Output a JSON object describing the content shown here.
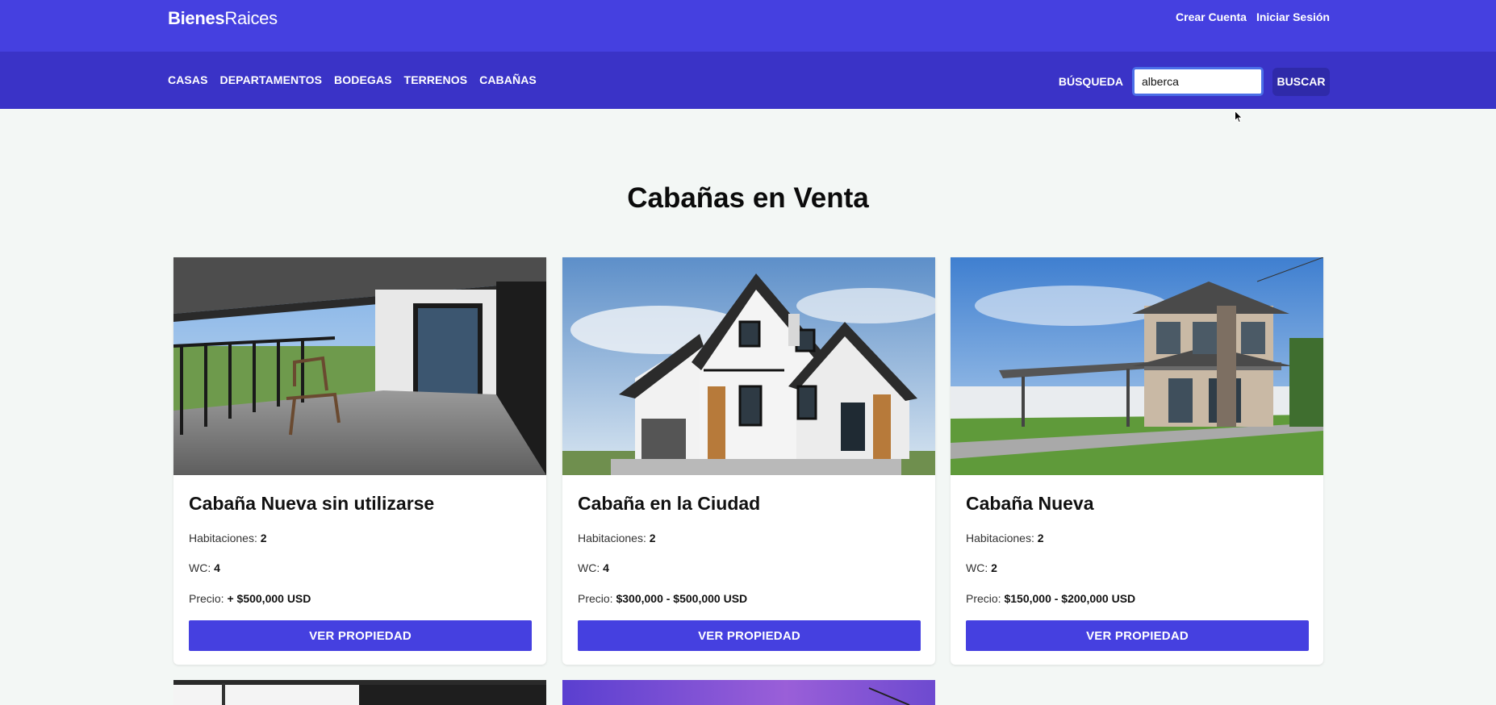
{
  "header": {
    "logo_bold": "Bienes",
    "logo_light": "Raices",
    "auth_links": [
      "Crear Cuenta",
      "Iniciar Sesión"
    ]
  },
  "nav": {
    "categories": [
      "CASAS",
      "DEPARTAMENTOS",
      "BODEGAS",
      "TERRENOS",
      "CABAÑAS"
    ],
    "search_label": "BÚSQUEDA",
    "search_value": "alberca",
    "search_button": "BUSCAR"
  },
  "page": {
    "title": "Cabañas en Venta"
  },
  "labels": {
    "rooms": "Habitaciones:",
    "wc": "WC:",
    "price": "Precio:",
    "view": "VER PROPIEDAD"
  },
  "listings": [
    {
      "title": "Cabaña Nueva sin utilizarse",
      "rooms": "2",
      "wc": "4",
      "price": "+ $500,000 USD"
    },
    {
      "title": "Cabaña en la Ciudad",
      "rooms": "2",
      "wc": "4",
      "price": "$300,000 - $500,000 USD"
    },
    {
      "title": "Cabaña Nueva",
      "rooms": "2",
      "wc": "2",
      "price": "$150,000 - $200,000 USD"
    }
  ],
  "colors": {
    "primary": "#4540e0",
    "nav_dark": "#3a33c7",
    "button_dark": "#2f2aa9",
    "page_bg": "#f3f7f5"
  }
}
